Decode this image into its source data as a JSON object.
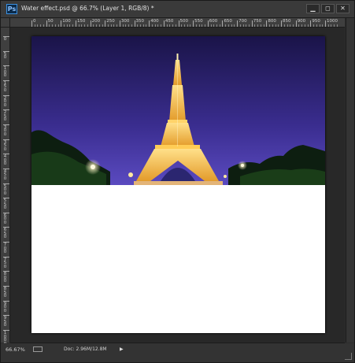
{
  "window": {
    "app_icon_text": "Ps",
    "title": "Water effect.psd @ 66.7% (Layer 1, RGB/8) *",
    "buttons": {
      "minimize": "▁",
      "restore": "◻",
      "close": "✕"
    }
  },
  "rulers": {
    "horizontal_labels": [
      "0",
      "50",
      "100",
      "150",
      "200",
      "250",
      "300",
      "350",
      "400",
      "450",
      "500",
      "550",
      "600",
      "650",
      "700",
      "750",
      "800",
      "850",
      "900",
      "950",
      "1000"
    ],
    "vertical_labels": [
      "0",
      "5 0",
      "1 0 0",
      "1 5 0",
      "2 0 0",
      "2 5 0",
      "3 0 0",
      "3 5 0",
      "4 0 0",
      "4 5 0",
      "5 0 0",
      "5 5 0",
      "6 0 0",
      "6 5 0",
      "7 0 0",
      "7 5 0",
      "8 0 0",
      "8 5 0",
      "9 0 0",
      "9 5 0",
      "1 0 0 0"
    ]
  },
  "image": {
    "subject": "Eiffel Tower at night",
    "colors": {
      "sky_top": "#1a1448",
      "sky_bottom": "#4a38b0",
      "tower_light": "#f2b341",
      "trees": "#0d1e10",
      "canvas_blank": "#ffffff"
    }
  },
  "status": {
    "zoom": "66.67%",
    "doc_info": "Doc: 2.96M/12.8M",
    "arrow": "▶"
  }
}
